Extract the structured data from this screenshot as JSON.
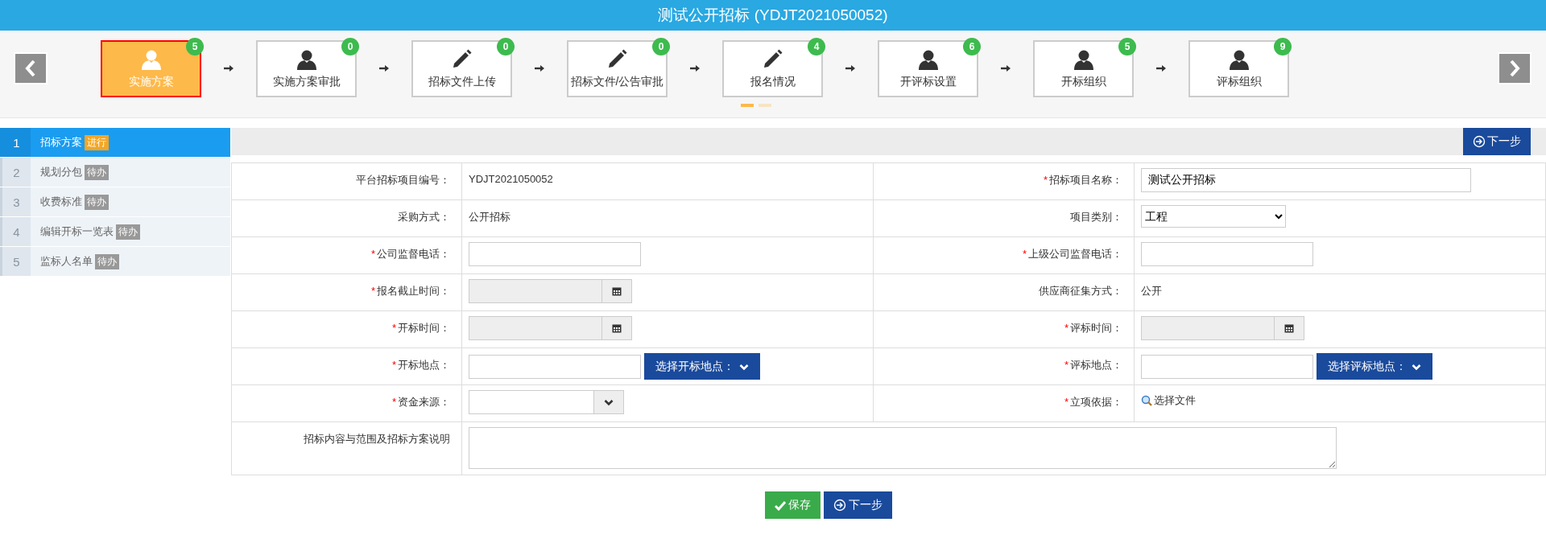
{
  "window": {
    "title": "测试公开招标 (YDJT2021050052)"
  },
  "steps": [
    {
      "label": "实施方案",
      "kind": "person",
      "count": "5",
      "selected": true
    },
    {
      "label": "实施方案审批",
      "kind": "person",
      "count": "0",
      "selected": false
    },
    {
      "label": "招标文件上传",
      "kind": "pencil",
      "count": "0",
      "selected": false
    },
    {
      "label": "招标文件/公告审批",
      "kind": "pencil",
      "count": "0",
      "selected": false
    },
    {
      "label": "报名情况",
      "kind": "pencil",
      "count": "4",
      "selected": false
    },
    {
      "label": "开评标设置",
      "kind": "person",
      "count": "6",
      "selected": false
    },
    {
      "label": "开标组织",
      "kind": "person",
      "count": "5",
      "selected": false
    },
    {
      "label": "评标组织",
      "kind": "person",
      "count": "9",
      "selected": false
    }
  ],
  "pager": [
    {
      "selected": true
    },
    {
      "selected": false
    }
  ],
  "sidebar": {
    "items": [
      {
        "number": "1",
        "label": "招标方案",
        "tag": "进行",
        "selected": true
      },
      {
        "number": "2",
        "label": "规划分包",
        "tag": "待办",
        "selected": false
      },
      {
        "number": "3",
        "label": "收费标准",
        "tag": "待办",
        "selected": false
      },
      {
        "number": "4",
        "label": "编辑开标一览表",
        "tag": "待办",
        "selected": false
      },
      {
        "number": "5",
        "label": "监标人名单",
        "tag": "待办",
        "selected": false
      }
    ]
  },
  "toolbar": {
    "next_button": "下一步"
  },
  "form": {
    "rows": [
      {
        "fields": [
          {
            "label": "平台招标项目编号：",
            "kind": "text",
            "value": "YDJT2021050052"
          },
          {
            "marker": "*",
            "label": "招标项目名称：",
            "kind": "input",
            "value": "测试公开招标"
          }
        ]
      },
      {
        "fields": [
          {
            "label": "采购方式：",
            "kind": "text",
            "value": "公开招标"
          },
          {
            "label": "项目类别：",
            "kind": "select",
            "value": "工程"
          }
        ]
      },
      {
        "fields": [
          {
            "marker": "*",
            "label": "公司监督电话：",
            "kind": "input"
          },
          {
            "marker": "*",
            "label": "上级公司监督电话：",
            "kind": "input"
          }
        ]
      },
      {
        "fields": [
          {
            "marker": "*",
            "label": "报名截止时间：",
            "kind": "date"
          },
          {
            "label": "供应商征集方式：",
            "kind": "text",
            "value": "公开"
          }
        ]
      },
      {
        "fields": [
          {
            "marker": "*",
            "label": "开标时间：",
            "kind": "date"
          },
          {
            "marker": "*",
            "label": "评标时间：",
            "kind": "date"
          }
        ]
      },
      {
        "fields": [
          {
            "marker": "*",
            "label": "开标地点：",
            "kind": "location",
            "button": "选择开标地点："
          },
          {
            "marker": "*",
            "label": "评标地点：",
            "kind": "location",
            "button": "选择评标地点："
          }
        ]
      },
      {
        "fields": [
          {
            "marker": "*",
            "label": "资金来源：",
            "kind": "combo"
          },
          {
            "marker": "*",
            "label": "立项依据：",
            "kind": "file",
            "value": "选择文件"
          }
        ]
      },
      {
        "fields": [
          {
            "label": "招标内容与范围及招标方案说明",
            "kind": "textarea"
          }
        ]
      }
    ]
  },
  "actions": [
    {
      "kind": "save",
      "label": "保存"
    },
    {
      "kind": "next",
      "label": "下一步"
    }
  ]
}
